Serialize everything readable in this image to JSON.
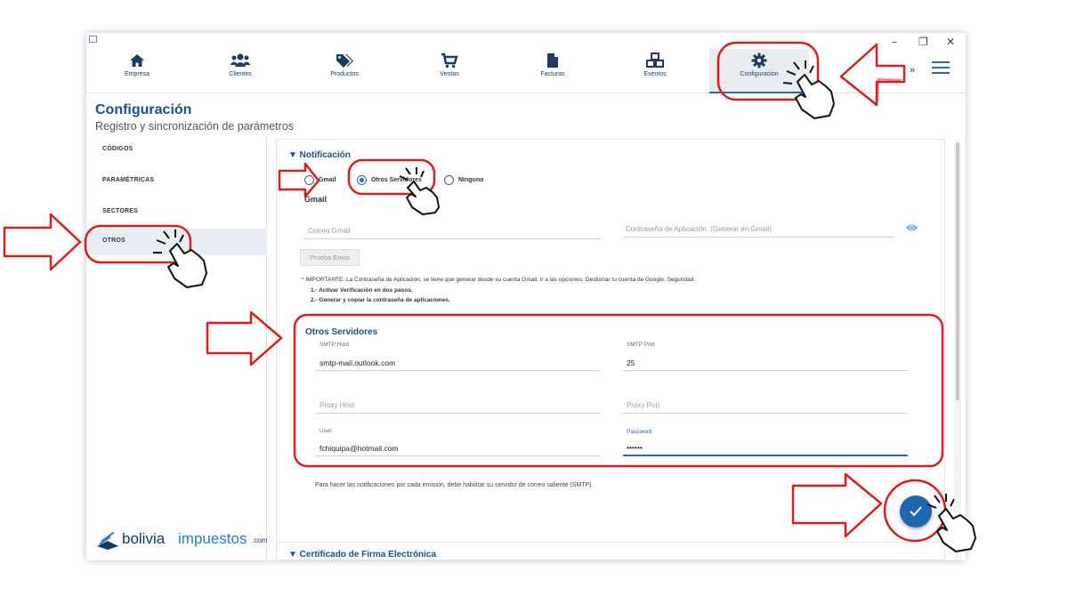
{
  "nav": {
    "items": [
      {
        "label": "Empresa",
        "icon": "home-icon"
      },
      {
        "label": "Clientes",
        "icon": "users-icon"
      },
      {
        "label": "Productos",
        "icon": "tags-icon"
      },
      {
        "label": "Ventas",
        "icon": "cart-icon"
      },
      {
        "label": "Facturas",
        "icon": "document-icon"
      },
      {
        "label": "Eventos",
        "icon": "cubes-icon"
      },
      {
        "label": "Configuracion",
        "icon": "gear-icon"
      }
    ],
    "more": "»"
  },
  "header": {
    "title": "Configuración",
    "subtitle": "Registro y sincronización de parámetros"
  },
  "sidebar": {
    "items": [
      {
        "label": "CÓDIGOS"
      },
      {
        "label": "PARAMÉTRICAS"
      },
      {
        "label": "SECTORES"
      },
      {
        "label": "OTROS"
      }
    ]
  },
  "notificacion": {
    "title": "▼ Notificación",
    "options": [
      "Gmail",
      "Otros Servidores",
      "Ninguno"
    ],
    "selected": "Otros Servidores",
    "gmail": {
      "title": "Gmail",
      "correo_placeholder": "Correo Gmail",
      "password_placeholder": "Contraseña de Aplicación. (Generar en Gmail)",
      "test_button": "Prueba Envio",
      "note": "* IMPORTANTE. La Contraseña de Aplicación, se tiene que generar desde su cuenta Gmail, ir a las opciones: Gestionar tu cuenta de Google, Seguridad.",
      "step1": "1.- Activar Verificación en dos pasos.",
      "step2": "2.- Generar y copiar la contraseña de aplicaciones."
    },
    "otros": {
      "title": "Otros Servidores",
      "smtp_host_label": "SMTP Host",
      "smtp_host": "smtp-mail.outlook.com",
      "smtp_port_label": "SMTP Port",
      "smtp_port": "25",
      "proxy_host_placeholder": "Proxy Host",
      "proxy_port_placeholder": "Proxy Port",
      "user_label": "User",
      "user": "fchiquipa@hotmail.com",
      "password_label": "Password",
      "password": "••••••"
    },
    "footer": "Para hacer las notificaciones por cada emisión, debe habilitar su servidor de correo saliente (SMTP)."
  },
  "next_section": "▼ Certificado de Firma Electrónica",
  "logo": {
    "part1": "bolivia",
    "part2": "impuestos",
    "part3": ".com"
  },
  "window_controls": {
    "minimize": "–",
    "maximize": "❐",
    "close": "✕"
  },
  "colors": {
    "accent": "#2a6cb2",
    "title": "#1f4e84",
    "annotation": "#d81e1e"
  }
}
